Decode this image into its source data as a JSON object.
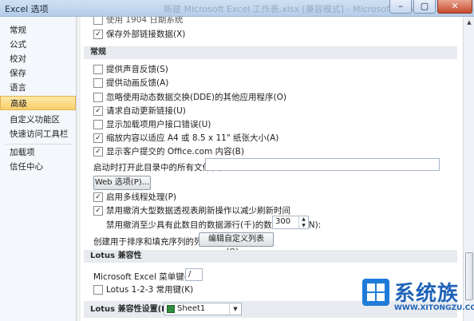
{
  "window": {
    "title": "Excel 选项",
    "ghost_title": "新建 Microsoft Excel 工作表.xlsx [兼容模式] - Microsoft Excel",
    "controls": [
      "–",
      "▢",
      "✕"
    ]
  },
  "sidebar": {
    "items": [
      {
        "label": "常规"
      },
      {
        "label": "公式"
      },
      {
        "label": "校对"
      },
      {
        "label": "保存"
      },
      {
        "label": "语言"
      },
      {
        "label": "高级",
        "active": true
      },
      {
        "label": "自定义功能区"
      },
      {
        "label": "快速访问工具栏"
      },
      {
        "label": "加载项"
      },
      {
        "label": "信任中心"
      }
    ]
  },
  "content": {
    "top_cutoff": {
      "text": "使用 1904 日期系统"
    },
    "save_links": {
      "label": "保存外部链接数据(X)",
      "checked": true
    },
    "general_header": "常规",
    "general_options": [
      {
        "label": "提供声音反馈(S)",
        "checked": false
      },
      {
        "label": "提供动画反馈(A)",
        "checked": false
      },
      {
        "label": "忽略使用动态数据交换(DDE)的其他应用程序(O)",
        "checked": false
      },
      {
        "label": "请求自动更新链接(U)",
        "checked": true
      },
      {
        "label": "显示加载项用户接口错误(U)",
        "checked": false
      },
      {
        "label": "缩放内容以适应 A4 或 8.5 x 11\" 纸张大小(A)",
        "checked": true
      },
      {
        "label": "显示客户提交的 Office.com 内容(B)",
        "checked": true
      }
    ],
    "startup_label": "启动时打开此目录中的所有文件(L):",
    "startup_value": "",
    "web_options_button": "Web 选项(P)...",
    "multithread": {
      "label": "启用多线程处理(P)",
      "checked": true
    },
    "disable_undo": {
      "label": "禁用撤消大型数据透视表刷新操作以减少刷新时间",
      "checked": true
    },
    "undo_rows_label": "禁用撤消至少具有此数目的数据源行(千)的数据透视表(N):",
    "undo_rows_value": "300",
    "custom_lists_label": "创建用于排序和填充序列的列表:",
    "custom_lists_button": "编辑自定义列表(O)...",
    "lotus_header": "Lotus 兼容性",
    "menu_key_label": "Microsoft Excel 菜单键(M):",
    "menu_key_value": "/",
    "lotus_nav": {
      "label": "Lotus 1-2-3 常用键(K)",
      "checked": false
    },
    "lotus_settings_label": "Lotus 兼容性设置(L):",
    "lotus_settings_value": "Sheet1"
  },
  "watermark": {
    "text": "系统族",
    "url": "WWW.XITONGZU.COM"
  },
  "colors": {
    "active_item": "#f8cf6b",
    "section_header": "#e7ebef",
    "title_bar": "#b6cde8"
  },
  "icons": {
    "check": "✓",
    "spin_up": "▲",
    "spin_down": "▼",
    "dropdown": "▼",
    "scroll_up": "▲"
  }
}
